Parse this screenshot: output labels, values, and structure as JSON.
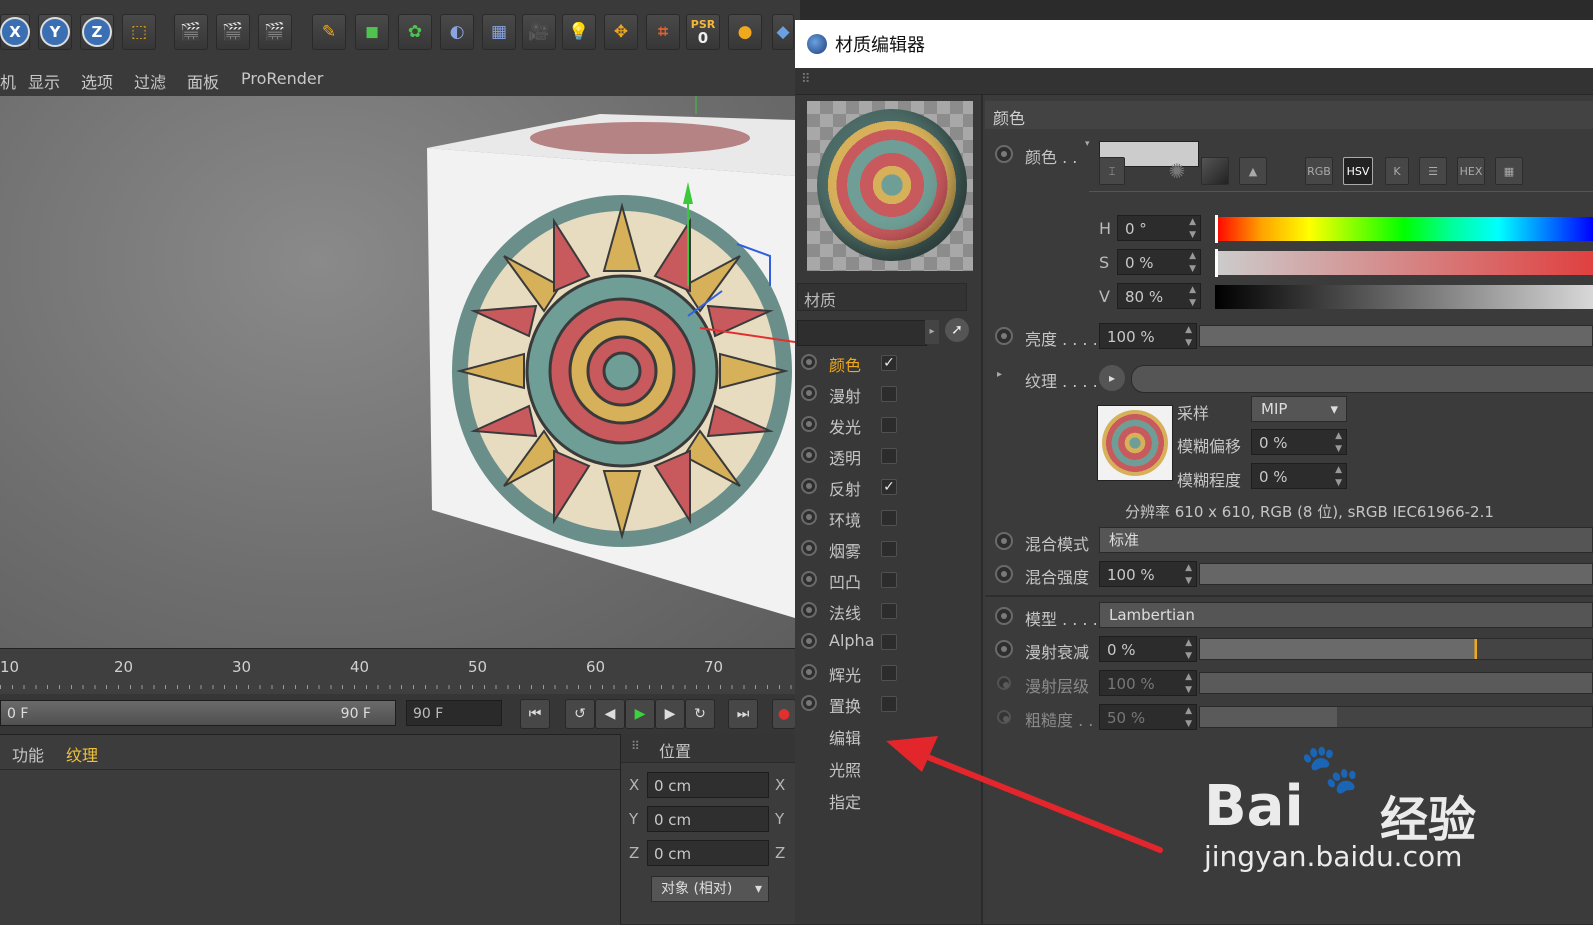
{
  "toolbar": {
    "axis_x": "X",
    "axis_y": "Y",
    "axis_z": "Z",
    "psr_label": "PSR",
    "psr_value": "0"
  },
  "view_menu": {
    "items": [
      "显示",
      "选项",
      "过滤",
      "面板",
      "ProRender"
    ],
    "cut_item": "机"
  },
  "timeline": {
    "ticks": [
      "10",
      "20",
      "30",
      "40",
      "50",
      "60",
      "70"
    ]
  },
  "playbar": {
    "start_frame": "0 F",
    "end_frame": "90 F",
    "current_field": "90 F"
  },
  "bottom_panel": {
    "tabs": [
      "功能",
      "纹理"
    ]
  },
  "coords": {
    "title": "位置",
    "rows": [
      {
        "axis": "X",
        "value": "0 cm",
        "axis_right": "X"
      },
      {
        "axis": "Y",
        "value": "0 cm",
        "axis_right": "Y"
      },
      {
        "axis": "Z",
        "value": "0 cm",
        "axis_right": "Z"
      }
    ],
    "mode_dropdown": "对象 (相对)"
  },
  "material_editor": {
    "window_title": "材质编辑器",
    "material_name": "材质",
    "channels": [
      {
        "label": "颜色",
        "checked": true,
        "active": true,
        "has_radio": true
      },
      {
        "label": "漫射",
        "checked": false,
        "active": false,
        "has_radio": true
      },
      {
        "label": "发光",
        "checked": false,
        "active": false,
        "has_radio": true
      },
      {
        "label": "透明",
        "checked": false,
        "active": false,
        "has_radio": true
      },
      {
        "label": "反射",
        "checked": true,
        "active": false,
        "has_radio": true
      },
      {
        "label": "环境",
        "checked": false,
        "active": false,
        "has_radio": true
      },
      {
        "label": "烟雾",
        "checked": false,
        "active": false,
        "has_radio": true
      },
      {
        "label": "凹凸",
        "checked": false,
        "active": false,
        "has_radio": true
      },
      {
        "label": "法线",
        "checked": false,
        "active": false,
        "has_radio": true
      },
      {
        "label": "Alpha",
        "checked": false,
        "active": false,
        "has_radio": true
      },
      {
        "label": "辉光",
        "checked": false,
        "active": false,
        "has_radio": true
      },
      {
        "label": "置换",
        "checked": false,
        "active": false,
        "has_radio": true
      }
    ],
    "extra_items": [
      "编辑",
      "光照",
      "指定"
    ],
    "section_title": "颜色",
    "color_label": "颜色 . .",
    "mode_buttons": [
      "RGB",
      "HSV",
      "K",
      "HEX"
    ],
    "hsv": [
      {
        "label": "H",
        "value": "0 °"
      },
      {
        "label": "S",
        "value": "0 %"
      },
      {
        "label": "V",
        "value": "80 %"
      }
    ],
    "brightness": {
      "label": "亮度 . . . .",
      "value": "100 %"
    },
    "texture": {
      "label": "纹理 . . . ."
    },
    "sampling": {
      "label": "采样",
      "value": "MIP"
    },
    "blur_offset": {
      "label": "模糊偏移",
      "value": "0 %"
    },
    "blur_scale": {
      "label": "模糊程度",
      "value": "0 %"
    },
    "resolution_text": "分辨率 610 x 610, RGB (8 位), sRGB IEC61966-2.1",
    "blend_mode": {
      "label": "混合模式",
      "value": "标准"
    },
    "blend_strength": {
      "label": "混合强度",
      "value": "100 %"
    },
    "model": {
      "label": "模型 . . . .",
      "value": "Lambertian"
    },
    "diffuse_falloff": {
      "label": "漫射衰减",
      "value": "0 %"
    },
    "diffuse_level": {
      "label": "漫射层级",
      "value": "100 %"
    },
    "roughness": {
      "label": "粗糙度 . .",
      "value": "50 %"
    }
  },
  "watermark": {
    "brand": "Bai",
    "brand_cn": "经验",
    "url": "jingyan.baidu.com"
  },
  "colors": {
    "active_channel": "#f0a81c",
    "annotation_arrow": "#e3262b",
    "axis_blue": "#3b6fb3"
  }
}
